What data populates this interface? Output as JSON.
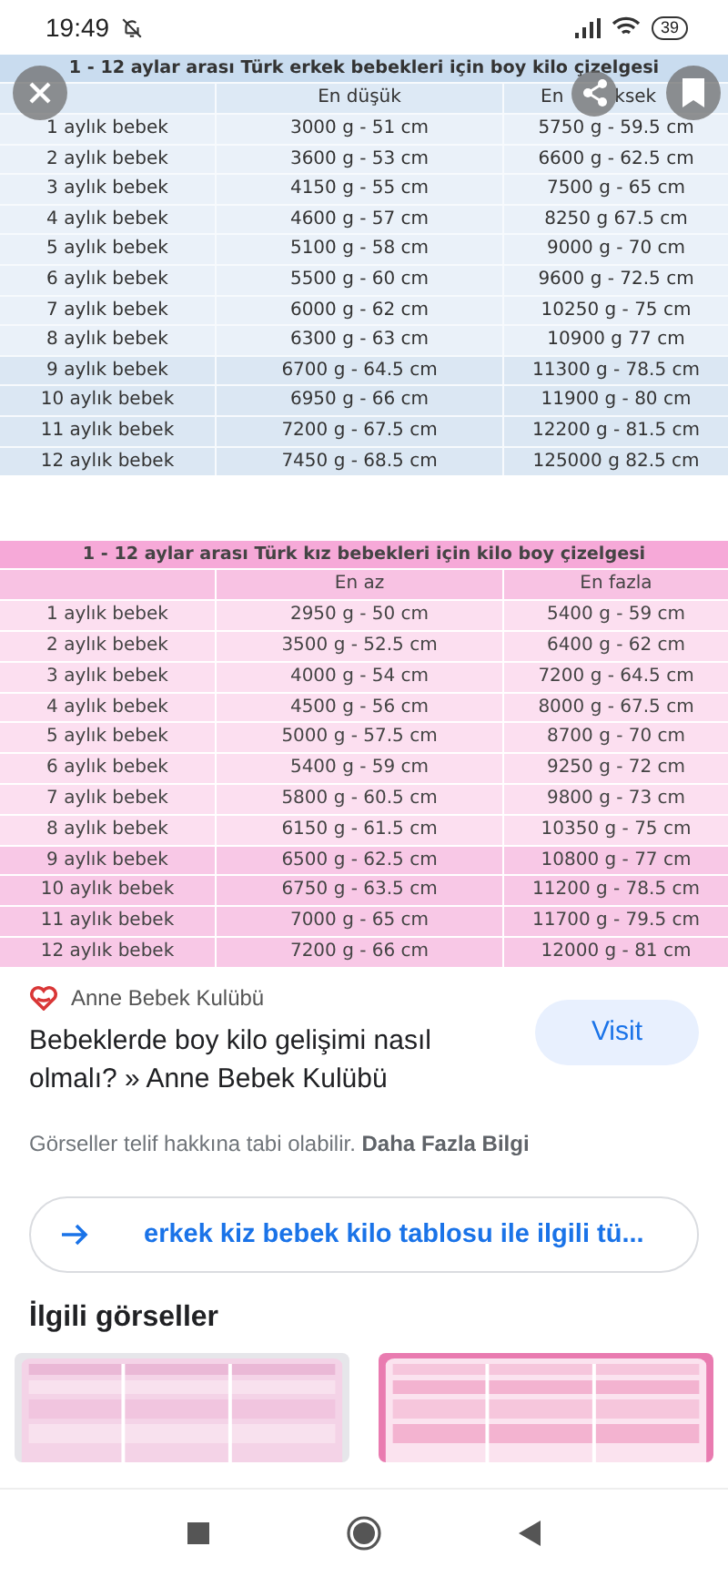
{
  "status_bar": {
    "time": "19:49",
    "battery": "39"
  },
  "image": {
    "tables": [
      {
        "kind": "blue",
        "title": "1 - 12 aylar arası Türk erkek bebekleri için boy kilo çizelgesi",
        "columns": [
          [
            "En düşük"
          ],
          [
            "En",
            "ksek"
          ]
        ],
        "rows": [
          {
            "label": "1 aylık bebek",
            "min": "3000 g - 51 cm",
            "max": "5750 g - 59.5 cm"
          },
          {
            "label": "2 aylık bebek",
            "min": "3600 g - 53 cm",
            "max": "6600 g - 62.5 cm"
          },
          {
            "label": "3 aylık bebek",
            "min": "4150 g - 55 cm",
            "max": "7500 g - 65 cm"
          },
          {
            "label": "4 aylık bebek",
            "min": "4600 g - 57 cm",
            "max": "8250 g 67.5 cm"
          },
          {
            "label": "5 aylık bebek",
            "min": "5100 g - 58 cm",
            "max": "9000 g - 70 cm"
          },
          {
            "label": "6 aylık bebek",
            "min": "5500 g - 60 cm",
            "max": "9600 g - 72.5 cm"
          },
          {
            "label": "7 aylık bebek",
            "min": "6000 g - 62 cm",
            "max": "10250 g - 75 cm"
          },
          {
            "label": "8 aylık bebek",
            "min": "6300 g - 63 cm",
            "max": "10900 g 77 cm"
          },
          {
            "label": "9 aylık bebek",
            "min": "6700 g - 64.5 cm",
            "max": "11300 g - 78.5 cm"
          },
          {
            "label": "10 aylık bebek",
            "min": "6950 g - 66 cm",
            "max": "11900 g - 80 cm"
          },
          {
            "label": "11 aylık bebek",
            "min": "7200 g - 67.5 cm",
            "max": "12200 g - 81.5 cm"
          },
          {
            "label": "12 aylık bebek",
            "min": "7450 g - 68.5 cm",
            "max": "125000 g 82.5 cm"
          }
        ]
      },
      {
        "kind": "pink",
        "title": "1 - 12 aylar arası Türk kız bebekleri için kilo boy çizelgesi",
        "columns": [
          [
            "En az"
          ],
          [
            "En fazla"
          ]
        ],
        "rows": [
          {
            "label": "1 aylık bebek",
            "min": "2950 g - 50 cm",
            "max": "5400 g - 59 cm"
          },
          {
            "label": "2 aylık bebek",
            "min": "3500 g - 52.5 cm",
            "max": "6400 g - 62 cm"
          },
          {
            "label": "3 aylık bebek",
            "min": "4000 g - 54 cm",
            "max": "7200 g - 64.5 cm"
          },
          {
            "label": "4 aylık bebek",
            "min": "4500 g - 56 cm",
            "max": "8000 g - 67.5 cm"
          },
          {
            "label": "5 aylık bebek",
            "min": "5000 g - 57.5 cm",
            "max": "8700 g - 70 cm"
          },
          {
            "label": "6 aylık bebek",
            "min": "5400 g - 59 cm",
            "max": "9250 g - 72 cm"
          },
          {
            "label": "7 aylık bebek",
            "min": "5800 g - 60.5 cm",
            "max": "9800 g - 73 cm"
          },
          {
            "label": "8 aylık bebek",
            "min": "6150 g - 61.5 cm",
            "max": "10350 g - 75 cm"
          },
          {
            "label": "9 aylık bebek",
            "min": "6500 g - 62.5 cm",
            "max": "10800 g - 77 cm"
          },
          {
            "label": "10 aylık bebek",
            "min": "6750 g - 63.5 cm",
            "max": "11200 g - 78.5 cm"
          },
          {
            "label": "11 aylık bebek",
            "min": "7000 g - 65 cm",
            "max": "11700 g - 79.5 cm"
          },
          {
            "label": "12 aylık bebek",
            "min": "7200 g - 66 cm",
            "max": "12000 g - 81 cm"
          }
        ]
      }
    ]
  },
  "source": {
    "name": "Anne Bebek Kulübü",
    "title": "Bebeklerde boy kilo gelişimi nasıl olmalı? » Anne Bebek Kulübü",
    "visit": "Visit",
    "notice": "Görseller telif hakkına tabi olabilir. **Daha Fazla Bilgi**"
  },
  "related_search": "erkek kiz bebek kilo tablosu ile ilgili tü...",
  "related": {
    "heading": "İlgili görseller"
  }
}
